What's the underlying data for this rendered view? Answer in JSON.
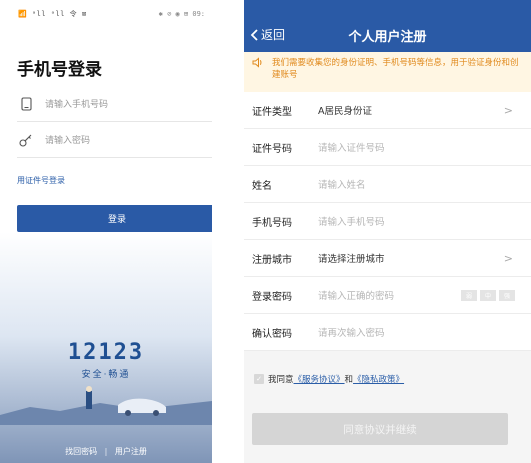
{
  "login": {
    "status_left": "📶 ᵃll ᵃll 令 ⊠",
    "status_right": "✱ ⊘ ◉ ⊞ 09:",
    "title": "手机号登录",
    "phone_placeholder": "请输入手机号码",
    "password_placeholder": "请输入密码",
    "cert_login_link": "用证件号登录",
    "login_button": "登录",
    "logo_number": "12123",
    "logo_slogan": "安全·畅通",
    "forgot_password": "找回密码",
    "divider": "|",
    "user_register": "用户注册"
  },
  "register": {
    "back_label": "返回",
    "page_title": "个人用户注册",
    "notice": "我们需要收集您的身份证明、手机号码等信息，用于验证身份和创建账号",
    "rows": [
      {
        "label": "证件类型",
        "value": "A居民身份证",
        "placeholder": "",
        "chevron": true
      },
      {
        "label": "证件号码",
        "value": "",
        "placeholder": "请输入证件号码",
        "chevron": false
      },
      {
        "label": "姓名",
        "value": "",
        "placeholder": "请输入姓名",
        "chevron": false
      },
      {
        "label": "手机号码",
        "value": "",
        "placeholder": "请输入手机号码",
        "chevron": false
      },
      {
        "label": "注册城市",
        "value": "请选择注册城市",
        "placeholder": "",
        "chevron": true
      },
      {
        "label": "登录密码",
        "value": "",
        "placeholder": "请输入正确的密码",
        "chevron": false
      },
      {
        "label": "确认密码",
        "value": "",
        "placeholder": "请再次输入密码",
        "chevron": false
      }
    ],
    "strength": [
      "弱",
      "中",
      "强"
    ],
    "agree_prefix": "我同意",
    "service_agreement": "《服务协议》",
    "and": "和",
    "privacy_policy": "《隐私政策》",
    "continue_button": "同意协议并继续"
  },
  "colors": {
    "brand": "#2a5aa6",
    "notice_bg": "#fff6e3",
    "notice_text": "#e08a1e",
    "disabled_button": "#d5d5d5"
  },
  "icons": [
    "phone-icon",
    "key-icon",
    "back-chevron-icon",
    "speaker-icon",
    "chevron-right-icon",
    "checkbox-icon"
  ]
}
